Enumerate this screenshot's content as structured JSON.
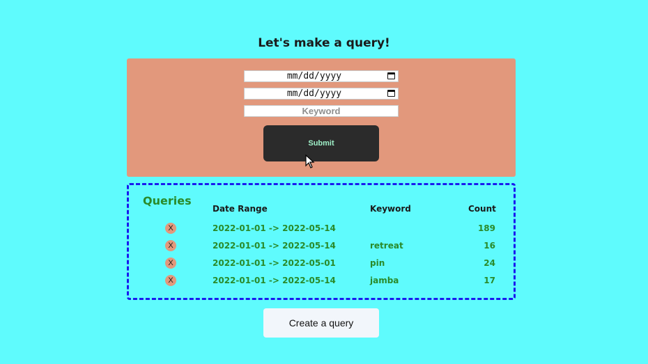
{
  "page_title": "Let's make a query!",
  "form": {
    "start_date_value": "mm/dd/yyyy",
    "end_date_value": "mm/dd/yyyy",
    "keyword_placeholder": "Keyword",
    "submit_label": "Submit"
  },
  "queries": {
    "title": "Queries",
    "columns": {
      "date_range": "Date Range",
      "keyword": "Keyword",
      "count": "Count"
    },
    "delete_label": "X",
    "rows": [
      {
        "date_range": "2022-01-01 -> 2022-05-14",
        "keyword": "",
        "count": "189"
      },
      {
        "date_range": "2022-01-01 -> 2022-05-14",
        "keyword": "retreat",
        "count": "16"
      },
      {
        "date_range": "2022-01-01 -> 2022-05-01",
        "keyword": "pin",
        "count": "24"
      },
      {
        "date_range": "2022-01-01 -> 2022-05-14",
        "keyword": "jamba",
        "count": "17"
      }
    ]
  },
  "create_query_label": "Create a query",
  "colors": {
    "background": "#5ffbfd",
    "form_panel": "#e2987c",
    "panel_border": "#1a1aee",
    "accent_text": "#2a8a2a",
    "submit_bg": "#2b2b2b"
  }
}
